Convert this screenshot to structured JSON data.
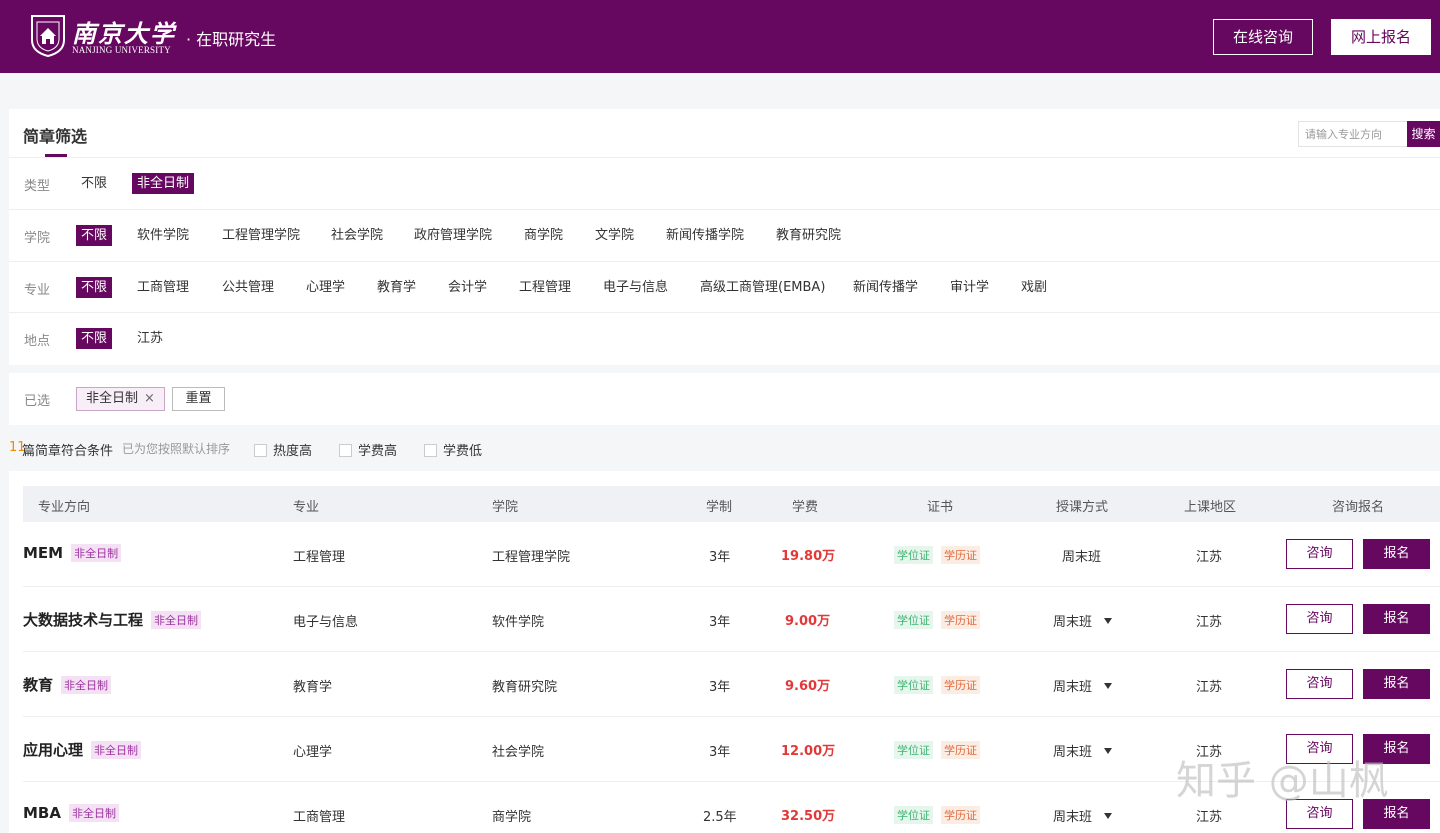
{
  "header": {
    "logo_cn": "南京大学",
    "logo_en": "NANJING UNIVERSITY",
    "subtitle": "· 在职研究生",
    "consult_label": "在线咨询",
    "apply_label": "网上报名"
  },
  "filter": {
    "title": "简章筛选",
    "search_placeholder": "请输入专业方向",
    "search_label": "搜索",
    "type": {
      "label": "类型",
      "options": [
        "不限",
        "非全日制"
      ]
    },
    "college": {
      "label": "学院",
      "options": [
        "不限",
        "软件学院",
        "工程管理学院",
        "社会学院",
        "政府管理学院",
        "商学院",
        "文学院",
        "新闻传播学院",
        "教育研究院"
      ]
    },
    "major": {
      "label": "专业",
      "options": [
        "不限",
        "工商管理",
        "公共管理",
        "心理学",
        "教育学",
        "会计学",
        "工程管理",
        "电子与信息",
        "高级工商管理(EMBA)",
        "新闻传播学",
        "审计学",
        "戏剧"
      ]
    },
    "location": {
      "label": "地点",
      "options": [
        "不限",
        "江苏"
      ]
    }
  },
  "selected": {
    "label": "已选",
    "chip": "非全日制",
    "chip_close": "×",
    "reset_label": "重置"
  },
  "sort": {
    "count": "11",
    "count_text": "篇简章符合条件",
    "hint": "已为您按照默认排序",
    "options": [
      "热度高",
      "学费高",
      "学费低"
    ]
  },
  "table": {
    "headers": [
      "专业方向",
      "专业",
      "学院",
      "学制",
      "学费",
      "证书",
      "授课方式",
      "上课地区",
      "咨询报名"
    ],
    "consult_label": "咨询",
    "apply_label": "报名",
    "rows": [
      {
        "name": "MEM",
        "mode": "非全日制",
        "major": "工程管理",
        "college": "工程管理学院",
        "years": "3年",
        "fee": "19.80万",
        "cert1": "学位证",
        "cert2": "学历证",
        "teaching": "周末班",
        "region": "江苏"
      },
      {
        "name": "大数据技术与工程",
        "mode": "非全日制",
        "major": "电子与信息",
        "college": "软件学院",
        "years": "3年",
        "fee": "9.00万",
        "cert1": "学位证",
        "cert2": "学历证",
        "teaching": "周末班",
        "region": "江苏"
      },
      {
        "name": "教育",
        "mode": "非全日制",
        "major": "教育学",
        "college": "教育研究院",
        "years": "3年",
        "fee": "9.60万",
        "cert1": "学位证",
        "cert2": "学历证",
        "teaching": "周末班",
        "region": "江苏"
      },
      {
        "name": "应用心理",
        "mode": "非全日制",
        "major": "心理学",
        "college": "社会学院",
        "years": "3年",
        "fee": "12.00万",
        "cert1": "学位证",
        "cert2": "学历证",
        "teaching": "周末班",
        "region": "江苏"
      },
      {
        "name": "MBA",
        "mode": "非全日制",
        "major": "工商管理",
        "college": "商学院",
        "years": "2.5年",
        "fee": "32.50万",
        "cert1": "学位证",
        "cert2": "学历证",
        "teaching": "周末班",
        "region": "江苏"
      }
    ]
  },
  "watermark": "知乎 @山枫",
  "colors": {
    "brand": "#66085f",
    "fee": "#e23838",
    "count": "#f08a00"
  }
}
